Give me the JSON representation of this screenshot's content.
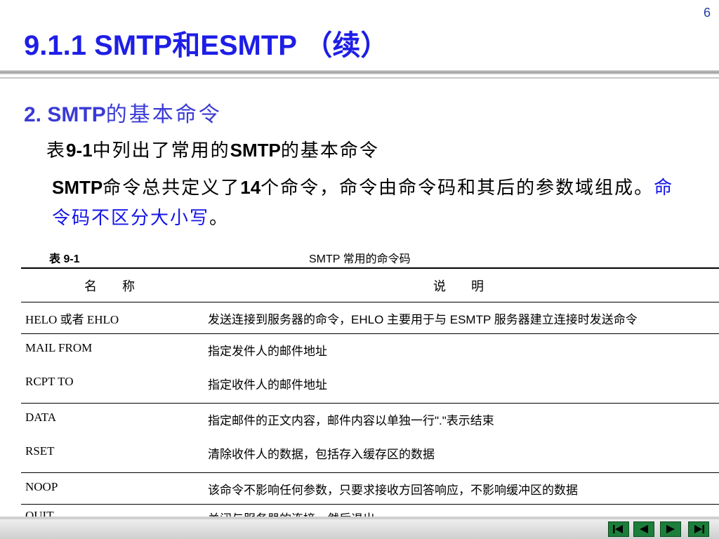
{
  "page": {
    "number": "6"
  },
  "title": {
    "text": "9.1.1 SMTP和ESMTP （续）"
  },
  "section": {
    "number": "2.",
    "latin": "SMTP",
    "chinese": "的基本命令"
  },
  "intro": {
    "prefix": "表",
    "table_ref": "9-1",
    "middle": "中列出了常用的",
    "smtp": "SMTP",
    "suffix": "的基本命令"
  },
  "paragraph": {
    "smtp": "SMTP",
    "text1": "命令总共定义了",
    "count": "14",
    "text2": "个命令，命令由命令码和其后的参数域组成。",
    "highlight": "命令码不区分大小写",
    "end": "。"
  },
  "table": {
    "number": "表 9-1",
    "caption": "SMTP 常用的命令码",
    "headers": [
      "名　　称",
      "说　　明"
    ],
    "rows": [
      {
        "name": "HELO 或者 EHLO",
        "desc": "发送连接到服务器的命令，EHLO 主要用于与 ESMTP 服务器建立连接时发送命令"
      },
      {
        "name": "MAIL FROM",
        "desc": "指定发件人的邮件地址"
      },
      {
        "name": "RCPT TO",
        "desc": "指定收件人的邮件地址"
      },
      {
        "name": "DATA",
        "desc": "指定邮件的正文内容，邮件内容以单独一行\".\"表示结束"
      },
      {
        "name": "RSET",
        "desc": "清除收件人的数据，包括存入缓存区的数据"
      },
      {
        "name": "NOOP",
        "desc": "该命令不影响任何参数，只要求接收方回答响应，不影响缓冲区的数据"
      },
      {
        "name": "QUIT",
        "desc": "关闭与服务器的连接，然后退出"
      }
    ]
  },
  "nav": {
    "buttons": [
      "first-slide-icon",
      "previous-slide-icon",
      "next-slide-icon",
      "last-slide-icon"
    ],
    "color": "#1b7e3a"
  }
}
